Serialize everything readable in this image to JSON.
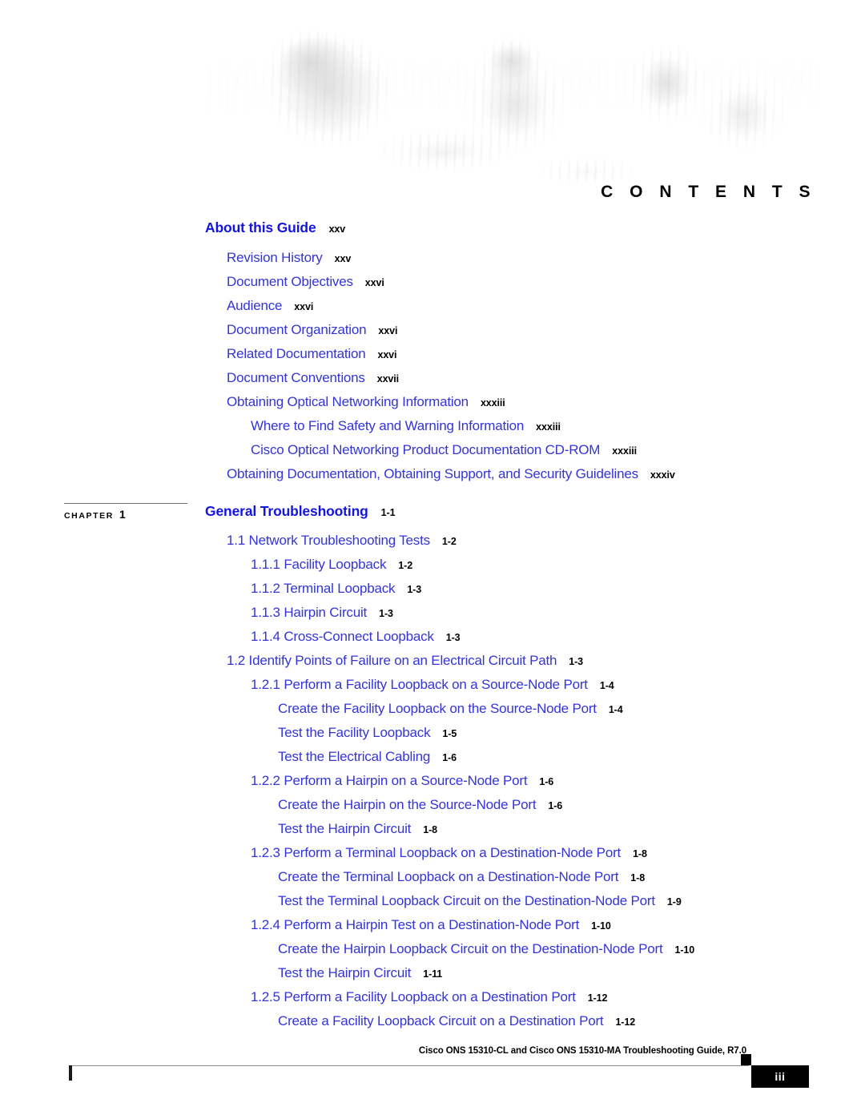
{
  "header": {
    "banner_title": "C O N T E N T S",
    "banner_alt": "cisco-people-banner-photo"
  },
  "colors": {
    "heading_blue": "#1414e0",
    "entry_blue": "#3434d8",
    "page_number_black": "#000000"
  },
  "front_matter": {
    "heading": {
      "title": "About this Guide",
      "page": "xxv"
    },
    "entries": [
      {
        "title": "Revision History",
        "page": "xxv",
        "level": 1
      },
      {
        "title": "Document Objectives",
        "page": "xxvi",
        "level": 1
      },
      {
        "title": "Audience",
        "page": "xxvi",
        "level": 1
      },
      {
        "title": "Document Organization",
        "page": "xxvi",
        "level": 1
      },
      {
        "title": "Related Documentation",
        "page": "xxvi",
        "level": 1
      },
      {
        "title": "Document Conventions",
        "page": "xxvii",
        "level": 1
      },
      {
        "title": "Obtaining Optical Networking Information",
        "page": "xxxiii",
        "level": 1
      },
      {
        "title": "Where to Find Safety and Warning Information",
        "page": "xxxiii",
        "level": 2
      },
      {
        "title": "Cisco Optical Networking Product Documentation CD-ROM",
        "page": "xxxiii",
        "level": 2
      },
      {
        "title": "Obtaining Documentation, Obtaining Support, and Security Guidelines",
        "page": "xxxiv",
        "level": 1
      }
    ]
  },
  "chapter": {
    "marker_label": "CHAPTER",
    "marker_number": "1",
    "heading": {
      "title": "General Troubleshooting",
      "page": "1-1"
    },
    "entries": [
      {
        "title": "1.1  Network Troubleshooting Tests",
        "page": "1-2",
        "level": 1
      },
      {
        "title": "1.1.1  Facility Loopback",
        "page": "1-2",
        "level": 2
      },
      {
        "title": "1.1.2  Terminal Loopback",
        "page": "1-3",
        "level": 2
      },
      {
        "title": "1.1.3  Hairpin Circuit",
        "page": "1-3",
        "level": 2
      },
      {
        "title": "1.1.4  Cross-Connect Loopback",
        "page": "1-3",
        "level": 2
      },
      {
        "title": "1.2  Identify Points of Failure on an Electrical Circuit Path",
        "page": "1-3",
        "level": 1
      },
      {
        "title": "1.2.1  Perform a Facility Loopback on a Source-Node Port",
        "page": "1-4",
        "level": 2
      },
      {
        "title": "Create the Facility Loopback on the Source-Node Port",
        "page": "1-4",
        "level": 3
      },
      {
        "title": "Test the Facility Loopback",
        "page": "1-5",
        "level": 3
      },
      {
        "title": "Test the Electrical Cabling",
        "page": "1-6",
        "level": 3
      },
      {
        "title": "1.2.2  Perform a Hairpin on a Source-Node Port",
        "page": "1-6",
        "level": 2
      },
      {
        "title": "Create the Hairpin on the Source-Node Port",
        "page": "1-6",
        "level": 3
      },
      {
        "title": "Test the Hairpin Circuit",
        "page": "1-8",
        "level": 3
      },
      {
        "title": "1.2.3  Perform a Terminal Loopback on a Destination-Node Port",
        "page": "1-8",
        "level": 2
      },
      {
        "title": "Create the Terminal Loopback on a Destination-Node Port",
        "page": "1-8",
        "level": 3
      },
      {
        "title": "Test the Terminal Loopback Circuit on the Destination-Node Port",
        "page": "1-9",
        "level": 3
      },
      {
        "title": "1.2.4  Perform a Hairpin Test on a Destination-Node Port",
        "page": "1-10",
        "level": 2
      },
      {
        "title": "Create the Hairpin Loopback Circuit on the Destination-Node Port",
        "page": "1-10",
        "level": 3
      },
      {
        "title": "Test the Hairpin Circuit",
        "page": "1-11",
        "level": 3
      },
      {
        "title": "1.2.5  Perform a Facility Loopback on a Destination Port",
        "page": "1-12",
        "level": 2
      },
      {
        "title": "Create a Facility Loopback Circuit on a Destination Port",
        "page": "1-12",
        "level": 3
      }
    ]
  },
  "footer": {
    "guide_title": "Cisco ONS 15310-CL and Cisco ONS 15310-MA Troubleshooting Guide, R7.0",
    "page_number": "iii"
  }
}
